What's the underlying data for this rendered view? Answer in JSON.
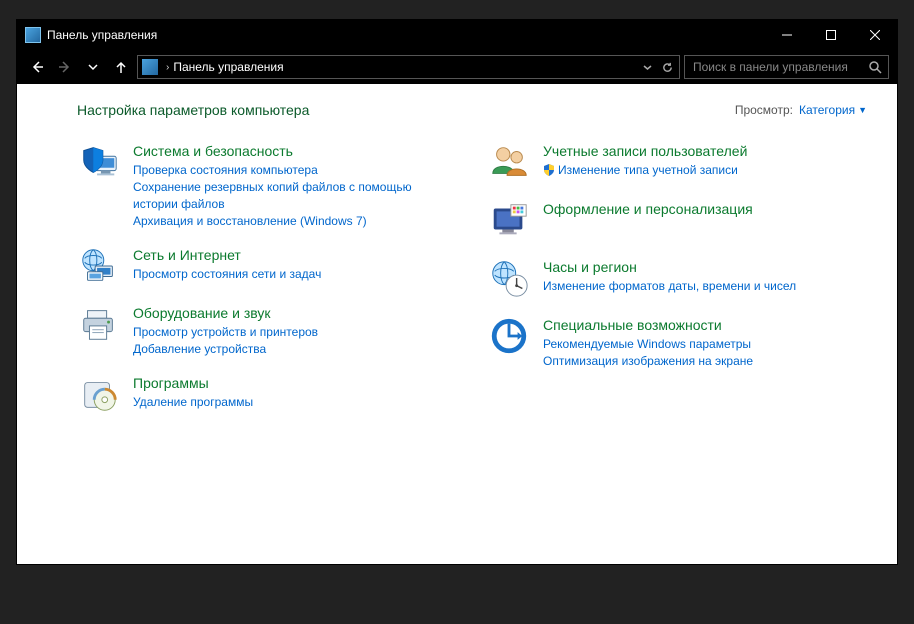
{
  "window": {
    "title": "Панель управления"
  },
  "navbar": {
    "breadcrumb_root": "Панель управления"
  },
  "search": {
    "placeholder": "Поиск в панели управления"
  },
  "header": {
    "heading": "Настройка параметров компьютера",
    "view_label": "Просмотр:",
    "view_value": "Категория"
  },
  "left": [
    {
      "title": "Система и безопасность",
      "links": [
        "Проверка состояния компьютера",
        "Сохранение резервных копий файлов с помощью истории файлов",
        "Архивация и восстановление (Windows 7)"
      ]
    },
    {
      "title": "Сеть и Интернет",
      "links": [
        "Просмотр состояния сети и задач"
      ]
    },
    {
      "title": "Оборудование и звук",
      "links": [
        "Просмотр устройств и принтеров",
        "Добавление устройства"
      ]
    },
    {
      "title": "Программы",
      "links": [
        "Удаление программы"
      ]
    }
  ],
  "right": [
    {
      "title": "Учетные записи пользователей",
      "links": [
        "Изменение типа учетной записи"
      ],
      "shielded": [
        true
      ]
    },
    {
      "title": "Оформление и персонализация",
      "links": []
    },
    {
      "title": "Часы и регион",
      "links": [
        "Изменение форматов даты, времени и чисел"
      ]
    },
    {
      "title": "Специальные возможности",
      "links": [
        "Рекомендуемые Windows параметры",
        "Оптимизация изображения на экране"
      ]
    }
  ]
}
